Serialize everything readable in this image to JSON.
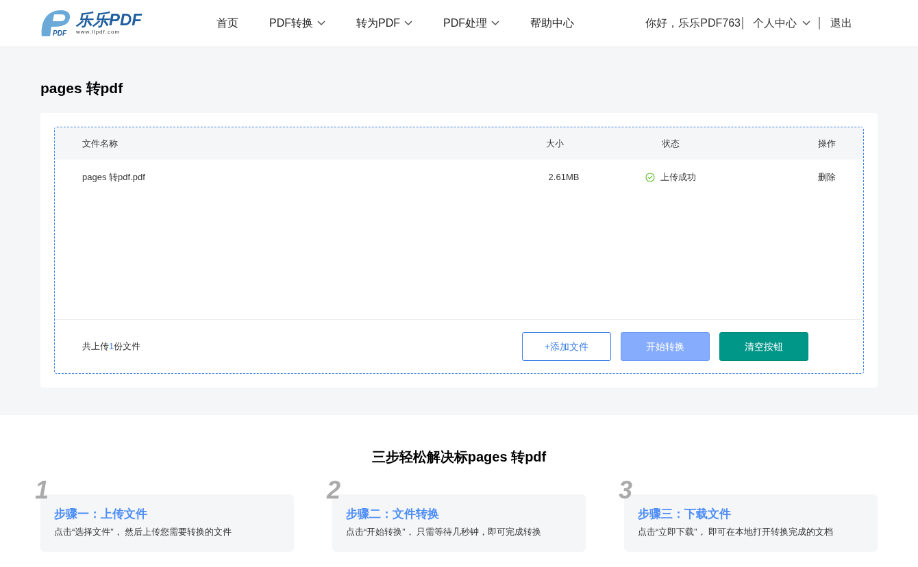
{
  "header": {
    "logo": {
      "mark": "PDF",
      "name": "乐乐PDF",
      "url": "www.llpdf.com"
    },
    "nav": [
      {
        "label": "首页",
        "dropdown": false
      },
      {
        "label": "PDF转换",
        "dropdown": true
      },
      {
        "label": "转为PDF",
        "dropdown": true
      },
      {
        "label": "PDF处理",
        "dropdown": true
      },
      {
        "label": "帮助中心",
        "dropdown": false
      }
    ],
    "greeting": "你好，乐乐PDF763",
    "user_menu": "个人中心",
    "logout": "退出"
  },
  "page_title": "pages 转pdf",
  "table": {
    "columns": [
      "文件名称",
      "大小",
      "状态",
      "操作"
    ],
    "rows": [
      {
        "name": "pages 转pdf.pdf",
        "size": "2.61MB",
        "status": "上传成功",
        "action": "删除"
      }
    ]
  },
  "summary": {
    "before": "共上传",
    "count": "1",
    "after": "份文件"
  },
  "buttons": [
    {
      "label": "+添加文件",
      "kind": "outline"
    },
    {
      "label": "开始转换",
      "kind": "light"
    },
    {
      "label": "清空按钮",
      "kind": "primary"
    }
  ],
  "steps_title": "三步轻松解决标pages 转pdf",
  "steps": [
    {
      "number": "1",
      "title": "步骤一：上传文件",
      "text": "点击“选择文件”， 然后上传您需要转换的文件"
    },
    {
      "number": "2",
      "title": "步骤二：文件转换",
      "text": "点击“开始转换”， 只需等待几秒钟，即可完成转换"
    },
    {
      "number": "3",
      "title": "步骤三：下载文件",
      "text": "点击“立即下载”， 即可在本地打开转换完成的文档"
    }
  ]
}
